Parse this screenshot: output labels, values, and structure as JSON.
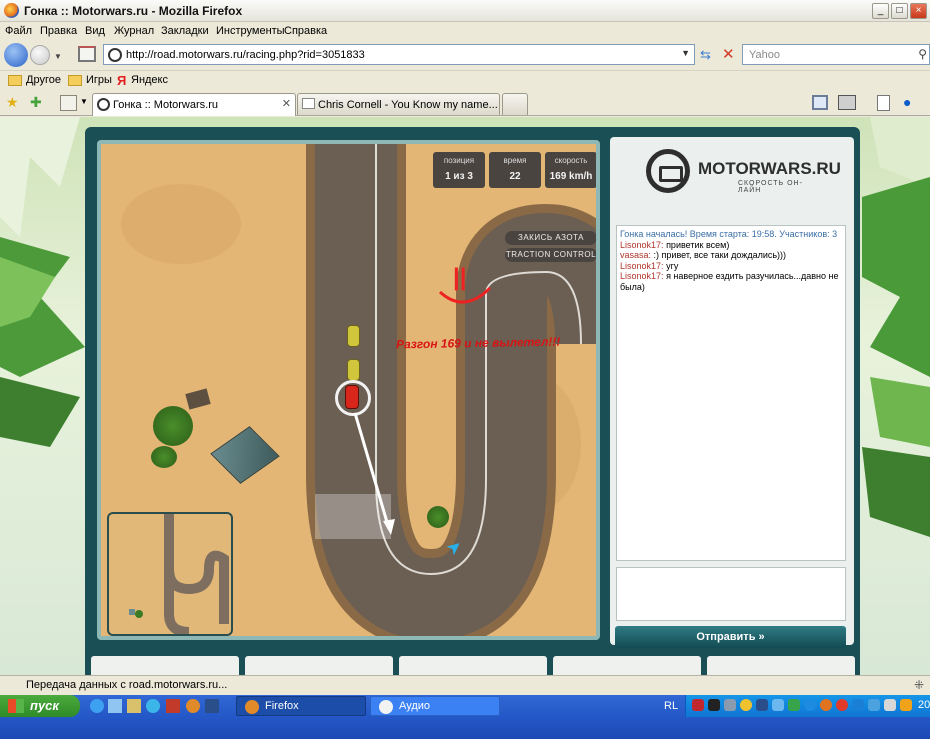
{
  "window": {
    "title": "Гонка :: Motorwars.ru - Mozilla Firefox"
  },
  "menu": [
    "Файл",
    "Правка",
    "Вид",
    "Журнал",
    "Закладки",
    "Инструменты",
    "Справка"
  ],
  "nav": {
    "url": "http://road.motorwars.ru/racing.php?rid=3051833",
    "search_placeholder": "Yahoo"
  },
  "bookmarks": [
    "Другое",
    "Игры",
    "Яндекс"
  ],
  "tabs": [
    {
      "label": "Гонка :: Motorwars.ru",
      "active": true
    },
    {
      "label": "Chris Cornell - You Know my name...",
      "active": false
    }
  ],
  "game": {
    "hud": [
      {
        "key": "позиция",
        "value": "1 из 3"
      },
      {
        "key": "время",
        "value": "22"
      },
      {
        "key": "скорость",
        "value": "169 km/h"
      }
    ],
    "buttons": {
      "nitro": "ЗАКИСЬ АЗОТА",
      "traction": "TRACTION CONTROL"
    },
    "annotation_face": "||",
    "annotation_text": "Разгон 169 и не вылетел!!!"
  },
  "site": {
    "logo_name": "MOTORWARS.RU",
    "logo_tagline": "СКОРОСТЬ ОН-ЛАЙН"
  },
  "chat": {
    "messages": [
      {
        "type": "system",
        "text": "Гонка началась! Время старта: 19:58. Участников: 3"
      },
      {
        "nick": "Lisonok17:",
        "text": "приветик всем)"
      },
      {
        "nick": "vasasa:",
        "text": ":) привет, все таки дождались)))"
      },
      {
        "nick": "Lisonok17:",
        "text": "угу"
      },
      {
        "nick": "Lisonok17:",
        "text": "я наверное ездить разучилась...давно не была)"
      }
    ],
    "send_label": "Отправить »"
  },
  "status": {
    "text": "Передача данных с road.motorwars.ru..."
  },
  "taskbar": {
    "start_label": "пуск",
    "items": [
      {
        "label": "Firefox"
      },
      {
        "label": "Аудио"
      }
    ],
    "lang": "RL",
    "clock": "20"
  },
  "colors": {
    "accent": "#1b4f56",
    "sand": "#e4b676",
    "road": "#6b5e53",
    "chat_nick": "#b0352b",
    "chat_system": "#3a6ea5"
  }
}
